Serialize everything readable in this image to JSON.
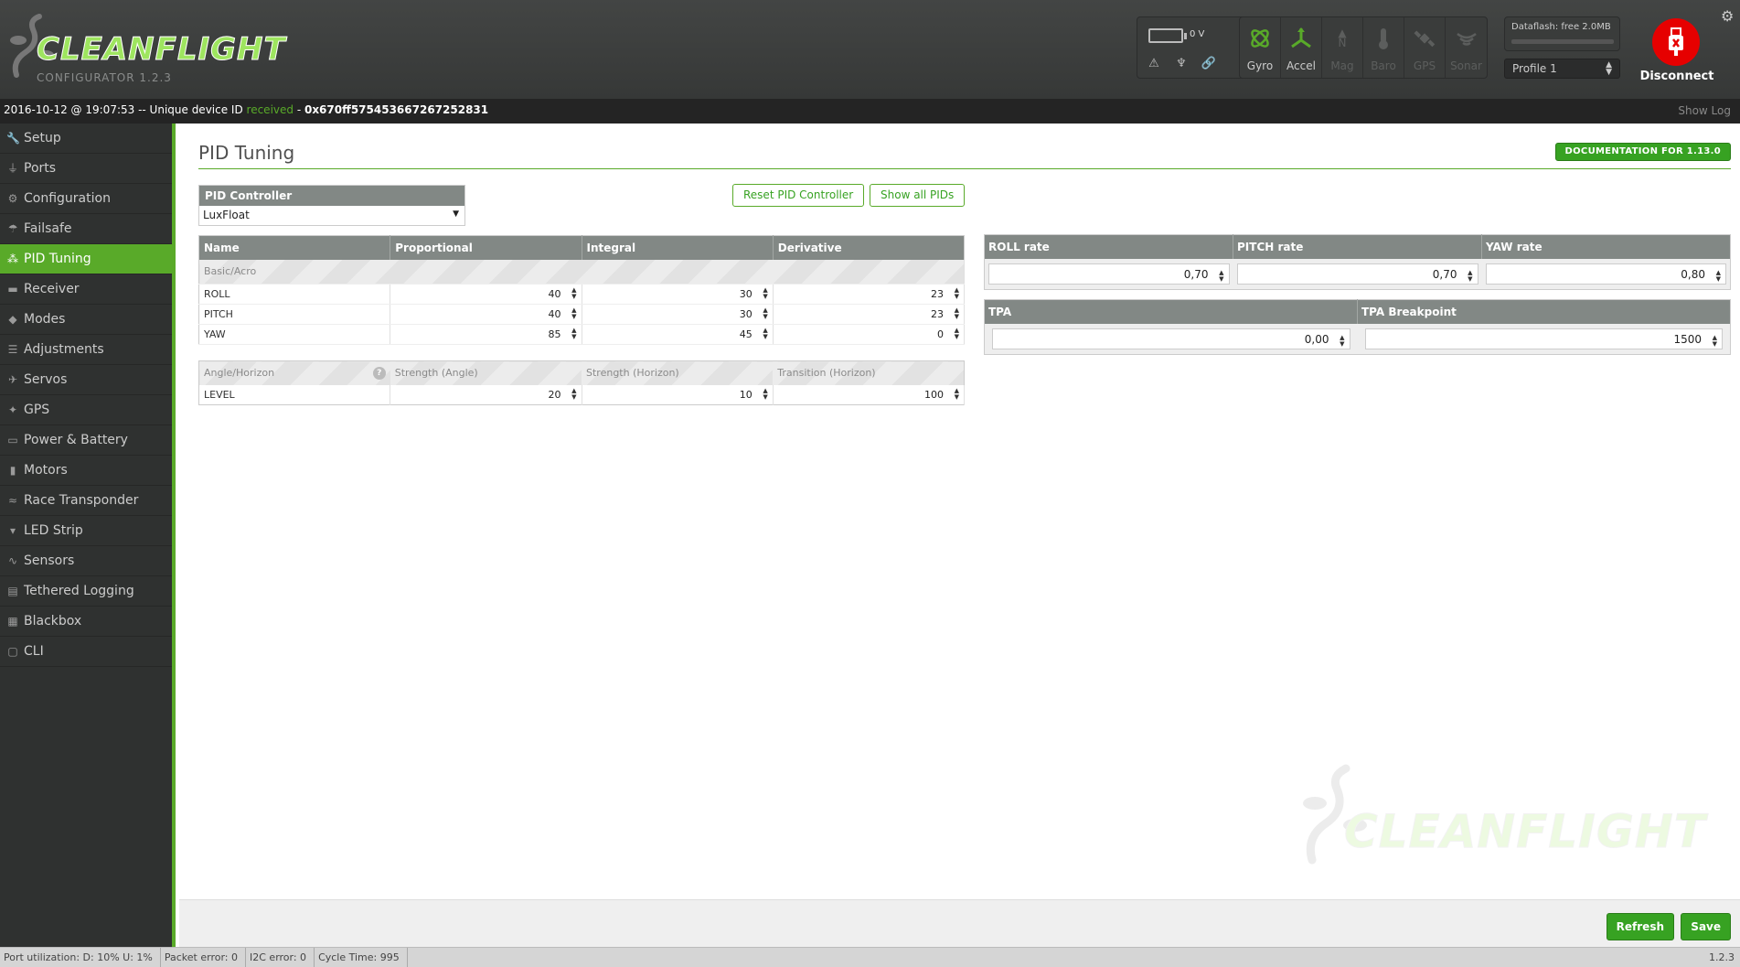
{
  "header": {
    "logo_text": "CLEANFLIGHT",
    "logo_sub": "CONFIGURATOR  1.2.3",
    "battery_voltage": "0 V",
    "sensors": [
      {
        "label": "Gyro",
        "icon": "gyro-icon",
        "active": true
      },
      {
        "label": "Accel",
        "icon": "accel-icon",
        "active": true
      },
      {
        "label": "Mag",
        "icon": "mag-icon",
        "active": false
      },
      {
        "label": "Baro",
        "icon": "baro-icon",
        "active": false
      },
      {
        "label": "GPS",
        "icon": "gps-icon",
        "active": false
      },
      {
        "label": "Sonar",
        "icon": "sonar-icon",
        "active": false
      }
    ],
    "dataflash": "Dataflash: free 2.0MB",
    "profile": "Profile 1",
    "connect_label": "Disconnect"
  },
  "statusline": {
    "prefix": "2016-10-12 @ 19:07:53 -- Unique device ID ",
    "received": "received",
    "dash": " - ",
    "device_id": "0x670ff575453667267252831",
    "show_log": "Show Log"
  },
  "sidebar": {
    "items": [
      {
        "label": "Setup",
        "icon": "wrench-icon"
      },
      {
        "label": "Ports",
        "icon": "plug-icon"
      },
      {
        "label": "Configuration",
        "icon": "gear-icon"
      },
      {
        "label": "Failsafe",
        "icon": "parachute-icon"
      },
      {
        "label": "PID Tuning",
        "icon": "pid-icon",
        "active": true
      },
      {
        "label": "Receiver",
        "icon": "receiver-icon"
      },
      {
        "label": "Modes",
        "icon": "modes-icon"
      },
      {
        "label": "Adjustments",
        "icon": "adjust-icon"
      },
      {
        "label": "Servos",
        "icon": "servo-icon"
      },
      {
        "label": "GPS",
        "icon": "satellite-icon"
      },
      {
        "label": "Power & Battery",
        "icon": "battery-icon"
      },
      {
        "label": "Motors",
        "icon": "motor-icon"
      },
      {
        "label": "Race Transponder",
        "icon": "transponder-icon"
      },
      {
        "label": "LED Strip",
        "icon": "led-icon"
      },
      {
        "label": "Sensors",
        "icon": "sensors-icon"
      },
      {
        "label": "Tethered Logging",
        "icon": "log-icon"
      },
      {
        "label": "Blackbox",
        "icon": "blackbox-icon"
      },
      {
        "label": "CLI",
        "icon": "terminal-icon"
      }
    ]
  },
  "main": {
    "title": "PID Tuning",
    "doc_button": "DOCUMENTATION FOR 1.13.0",
    "pid_controller_label": "PID Controller",
    "pid_controller_value": "LuxFloat",
    "reset_button": "Reset PID Controller",
    "show_all_button": "Show all PIDs",
    "pid_table": {
      "headers": [
        "Name",
        "Proportional",
        "Integral",
        "Derivative"
      ],
      "group": "Basic/Acro",
      "rows": [
        {
          "name": "ROLL",
          "p": "40",
          "i": "30",
          "d": "23"
        },
        {
          "name": "PITCH",
          "p": "40",
          "i": "30",
          "d": "23"
        },
        {
          "name": "YAW",
          "p": "85",
          "i": "45",
          "d": "0"
        }
      ]
    },
    "angle_table": {
      "headers": [
        "Angle/Horizon",
        "Strength (Angle)",
        "Strength (Horizon)",
        "Transition (Horizon)"
      ],
      "rows": [
        {
          "name": "LEVEL",
          "a": "20",
          "b": "10",
          "c": "100"
        }
      ]
    },
    "rates": {
      "headers": [
        "ROLL rate",
        "PITCH rate",
        "YAW rate"
      ],
      "values": [
        "0,70",
        "0,70",
        "0,80"
      ]
    },
    "tpa": {
      "headers": [
        "TPA",
        "TPA Breakpoint"
      ],
      "values": [
        "0,00",
        "1500"
      ]
    }
  },
  "toolbar": {
    "refresh": "Refresh",
    "save": "Save"
  },
  "footer": {
    "port_util": "Port utilization: D: 10% U: 1%",
    "packet_error": "Packet error: 0",
    "i2c_error": "I2C error: 0",
    "cycle_time": "Cycle Time: 995",
    "version": "1.2.3"
  },
  "colors": {
    "accent": "#59aa29",
    "button_green": "#37a222",
    "header_bg": "#3d3f3e",
    "sidebar_bg": "#2f3130",
    "table_header": "#828885",
    "disconnect_red": "#e60000"
  }
}
